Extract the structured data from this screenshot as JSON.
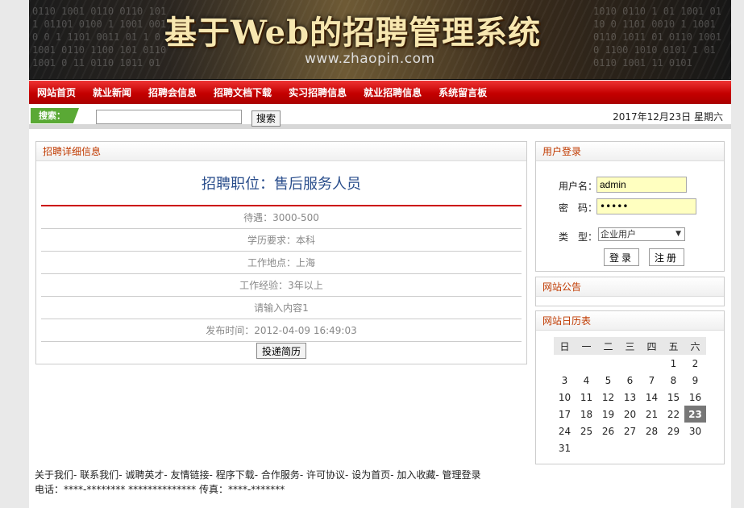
{
  "banner": {
    "title": "基于Web的招聘管理系统",
    "url": "www.zhaopin.com"
  },
  "nav": [
    "网站首页",
    "就业新闻",
    "招聘会信息",
    "招聘文档下载",
    "实习招聘信息",
    "就业招聘信息",
    "系统留言板"
  ],
  "search": {
    "tag": "搜索：",
    "value": "",
    "button": "搜索"
  },
  "date": "2017年12月23日 星期六",
  "detail": {
    "panel_title": "招聘详细信息",
    "job_title": "招聘职位：售后服务人员",
    "rows": [
      "待遇：3000-500",
      "学历要求：本科",
      "工作地点：上海",
      "工作经验：3年以上",
      "请输入内容1",
      "发布时间：2012-04-09 16:49:03"
    ],
    "apply_button": "投递简历"
  },
  "login": {
    "panel_title": "用户登录",
    "username_label": "用户名：",
    "username_value": "admin",
    "password_label": "密　码：",
    "password_value": "•••••",
    "type_label": "类　型：",
    "type_value": "企业用户",
    "login_button": "登录",
    "register_button": "注册"
  },
  "notice": {
    "panel_title": "网站公告"
  },
  "calendar": {
    "panel_title": "网站日历表",
    "weekdays": [
      "日",
      "一",
      "二",
      "三",
      "四",
      "五",
      "六"
    ],
    "weeks": [
      [
        "",
        "",
        "",
        "",
        "",
        "1",
        "2"
      ],
      [
        "3",
        "4",
        "5",
        "6",
        "7",
        "8",
        "9"
      ],
      [
        "10",
        "11",
        "12",
        "13",
        "14",
        "15",
        "16"
      ],
      [
        "17",
        "18",
        "19",
        "20",
        "21",
        "22",
        "23"
      ],
      [
        "24",
        "25",
        "26",
        "27",
        "28",
        "29",
        "30"
      ],
      [
        "31",
        "",
        "",
        "",
        "",
        "",
        ""
      ]
    ],
    "today": "23"
  },
  "footer": {
    "links": [
      "关于我们",
      "联系我们",
      "诚聘英才",
      "友情链接",
      "程序下载",
      "合作服务",
      "许可协议",
      "设为首页",
      "加入收藏",
      "管理登录"
    ],
    "separators": [
      "- ",
      "- ",
      "- ",
      "- ",
      "- ",
      "- ",
      "- ",
      "- ",
      "- ",
      ""
    ],
    "contact": "电话：****-********  **************  传真：****-*******"
  }
}
